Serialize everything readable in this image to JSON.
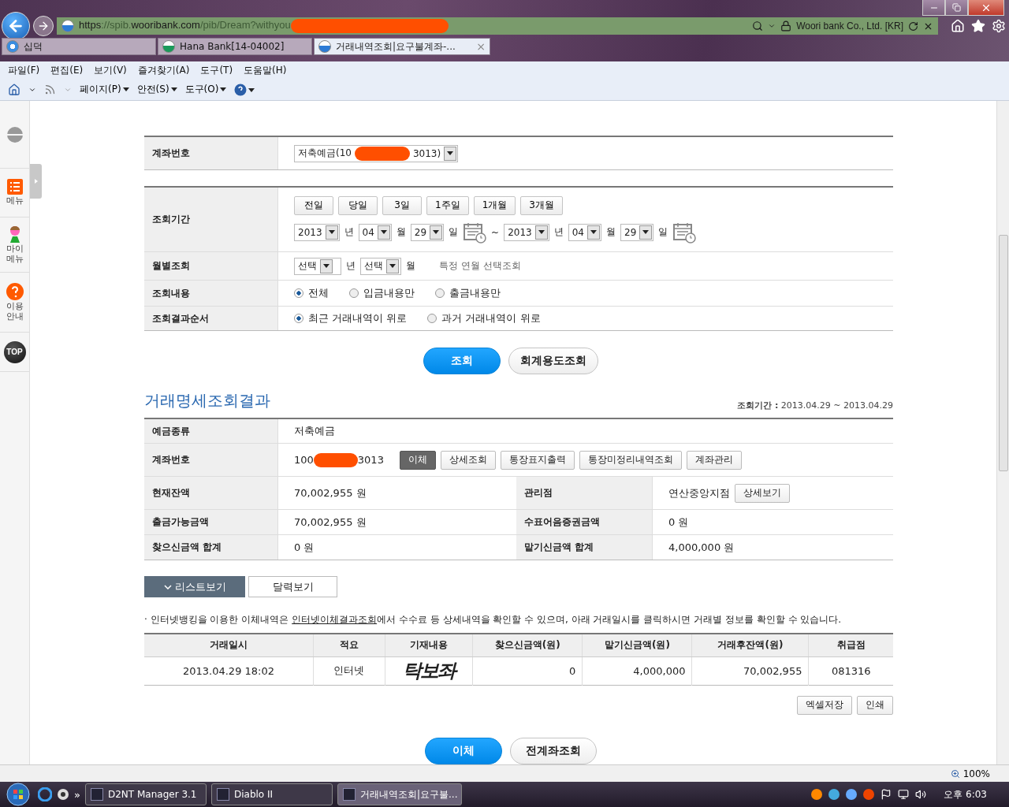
{
  "browser": {
    "url": {
      "scheme": "https",
      "host_prefix": "://spib.",
      "host": "wooribank.com",
      "path": "/pib/Dream?withyou"
    },
    "site_id": "Woori bank Co., Ltd. [KR]",
    "tabs": [
      {
        "label": "십덕",
        "selected": false,
        "kind": "ie"
      },
      {
        "label": "Hana Bank[14-04002]",
        "selected": false,
        "kind": "hana"
      },
      {
        "label": "거래내역조회|요구불계좌-...",
        "selected": true,
        "kind": "woori",
        "close": "×"
      }
    ],
    "menu": [
      "파일(F)",
      "편집(E)",
      "보기(V)",
      "즐겨찾기(A)",
      "도구(T)",
      "도움말(H)"
    ],
    "commands": [
      "페이지(P)",
      "안전(S)",
      "도구(O)"
    ]
  },
  "sidebar": [
    {
      "kind": "logo"
    },
    {
      "kind": "menu",
      "lines": [
        "메뉴"
      ]
    },
    {
      "kind": "my",
      "lines": [
        "마이",
        "메뉴"
      ]
    },
    {
      "kind": "help",
      "lines": [
        "이용",
        "안내"
      ]
    },
    {
      "kind": "top",
      "lines": [
        "TOP"
      ]
    }
  ],
  "account_row": {
    "label": "계좌번호",
    "value_start": "저축예금(10",
    "value_end": "3013)"
  },
  "period": {
    "label": "조회기간",
    "quick_buttons": [
      "전일",
      "당일",
      "3일",
      "1주일",
      "1개월",
      "3개월"
    ],
    "from": {
      "year": "2013",
      "year_unit": "년",
      "month": "04",
      "month_unit": "월",
      "day": "29",
      "day_unit": "일"
    },
    "separator": "~",
    "to": {
      "year": "2013",
      "year_unit": "년",
      "month": "04",
      "month_unit": "월",
      "day": "29",
      "day_unit": "일"
    }
  },
  "monthly": {
    "label": "월별조회",
    "year": "선택",
    "year_unit": "년",
    "month": "선택",
    "month_unit": "월",
    "hint": "특정 연월 선택조회"
  },
  "content_filter": {
    "label": "조회내용",
    "options": [
      {
        "label": "전체",
        "selected": true
      },
      {
        "label": "입금내용만",
        "selected": false
      },
      {
        "label": "출금내용만",
        "selected": false
      }
    ]
  },
  "order": {
    "label": "조회결과순서",
    "options": [
      {
        "label": "최근 거래내역이 위로",
        "selected": true
      },
      {
        "label": "과거 거래내역이 위로",
        "selected": false
      }
    ]
  },
  "search_buttons": [
    {
      "label": "조회",
      "kind": "primary"
    },
    {
      "label": "회계용도조회",
      "kind": "secondary"
    }
  ],
  "results": {
    "title": "거래명세조회결과",
    "period_label": "조회기간 :",
    "period": "2013.04.29 ~ 2013.04.29",
    "deposit_type": {
      "label": "예금종류",
      "value": "저축예금"
    },
    "account": {
      "label": "계좌번호",
      "value_start": "100",
      "value_end": "3013",
      "buttons": [
        {
          "label": "이체",
          "kind": "dark"
        },
        {
          "label": "상세조회",
          "kind": "plain"
        },
        {
          "label": "통장표지출력",
          "kind": "plain"
        },
        {
          "label": "통장미정리내역조회",
          "kind": "plain"
        },
        {
          "label": "계좌관리",
          "kind": "plain"
        }
      ]
    },
    "pairs": [
      {
        "label": "현재잔액",
        "value": "70,002,955 원",
        "label2": "관리점",
        "value2": "연산중앙지점",
        "button2": "상세보기"
      },
      {
        "label": "출금가능금액",
        "value": "70,002,955 원",
        "label2": "수표어음증권금액",
        "value2": "0 원"
      },
      {
        "label": "찾으신금액 합계",
        "value": "0 원",
        "label2": "맡기신금액 합계",
        "value2": "4,000,000 원"
      }
    ]
  },
  "view_tabs": [
    {
      "label": "리스트보기",
      "selected": true
    },
    {
      "label": "달력보기",
      "selected": false
    }
  ],
  "notice": {
    "bullet": "·",
    "before": "인터넷뱅킹을 이용한 이체내역은 ",
    "link": "인터넷이체결과조회",
    "after": "에서 수수료 등 상세내역을 확인할 수 있으며, 아래 거래일시를 클릭하시면 거래별 정보를 확인할 수 있습니다."
  },
  "table": {
    "columns": [
      "거래일시",
      "적요",
      "기재내용",
      "찾으신금액(원)",
      "맡기신금액(원)",
      "거래후잔액(원)",
      "취급점"
    ],
    "rows": [
      [
        "2013.04.29 18:02",
        "인터넷",
        "탁보좌",
        "0",
        "4,000,000",
        "70,002,955",
        "081316"
      ]
    ]
  },
  "table_actions": [
    "엑셀저장",
    "인쇄"
  ],
  "bottom_buttons": [
    {
      "label": "이체",
      "kind": "primary"
    },
    {
      "label": "전계좌조회",
      "kind": "secondary"
    }
  ],
  "status_bar": {
    "zoom": "100%"
  },
  "taskbar": {
    "more": "»",
    "items": [
      {
        "label": "D2NT Manager 3.1",
        "selected": false
      },
      {
        "label": "Diablo II",
        "selected": false
      },
      {
        "label": "거래내역조회|요구불...",
        "selected": true
      }
    ],
    "clock": "오후 6:03"
  }
}
